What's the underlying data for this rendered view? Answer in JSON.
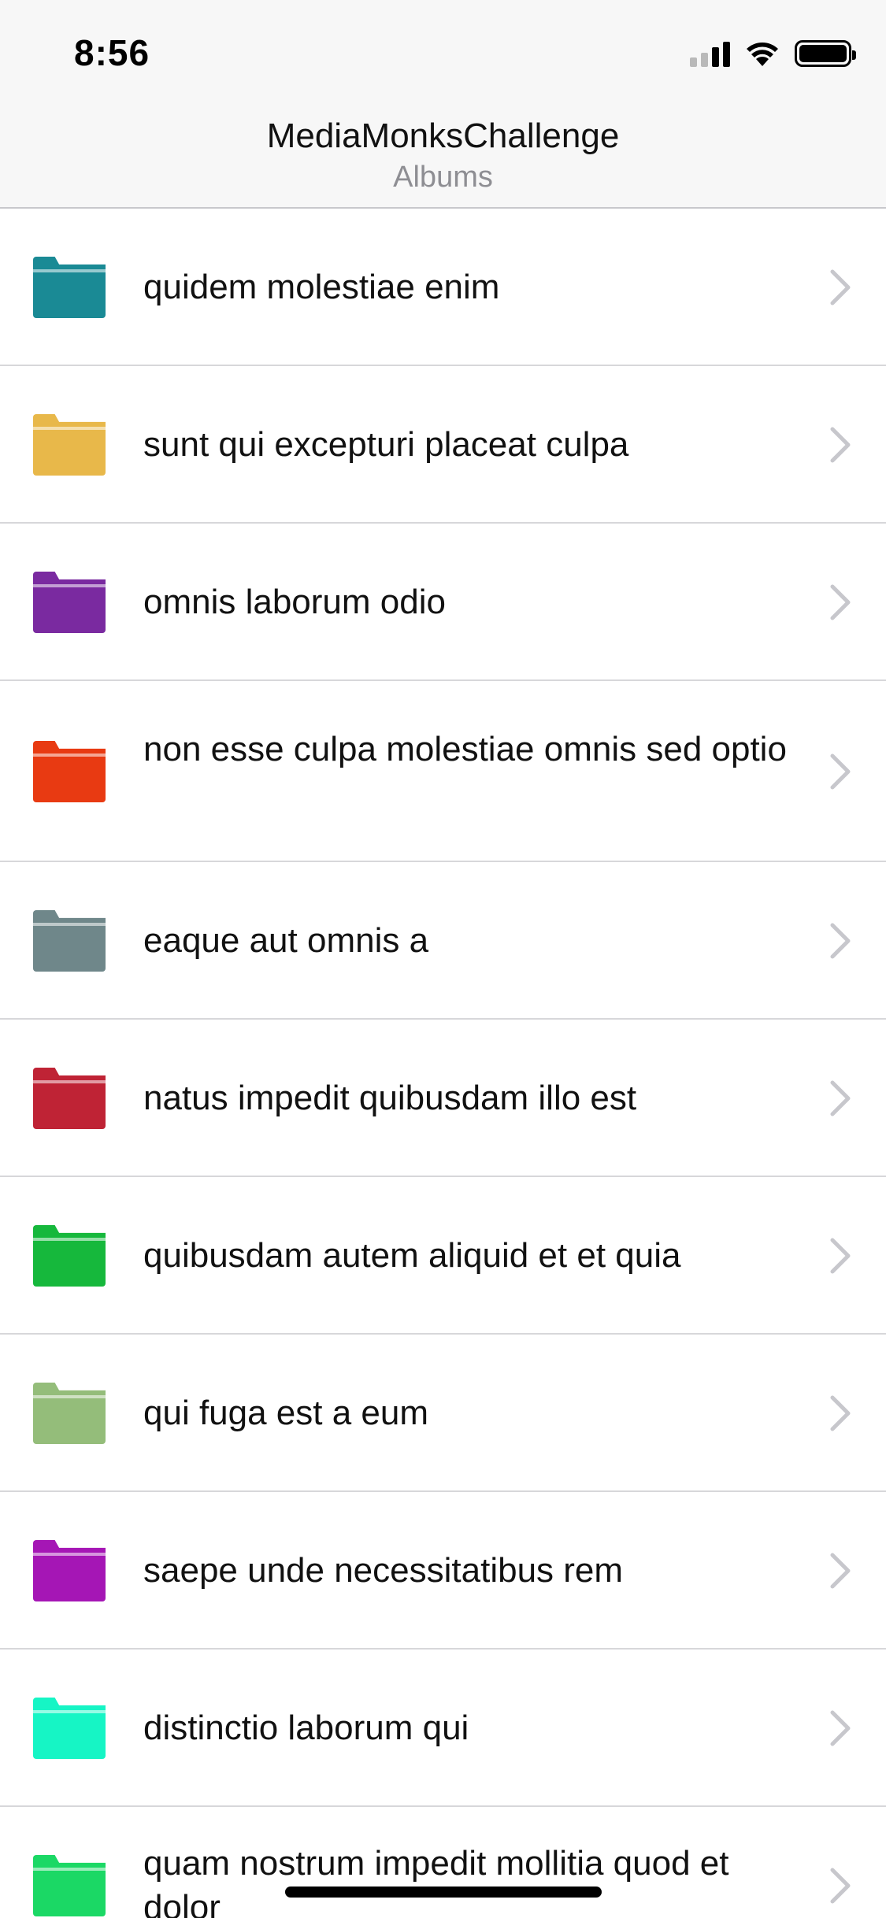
{
  "status_bar": {
    "time": "8:56"
  },
  "nav": {
    "title": "MediaMonksChallenge",
    "subtitle": "Albums"
  },
  "albums": [
    {
      "title": "quidem molestiae enim",
      "color": "#1a8a95"
    },
    {
      "title": "sunt qui excepturi placeat culpa",
      "color": "#e8b84a"
    },
    {
      "title": "omnis laborum odio",
      "color": "#7a2aa0"
    },
    {
      "title": "non esse culpa molestiae omnis sed optio",
      "color": "#e83a12"
    },
    {
      "title": "eaque aut omnis a",
      "color": "#6f878a"
    },
    {
      "title": "natus impedit quibusdam illo est",
      "color": "#bf2335"
    },
    {
      "title": "quibusdam autem aliquid et et quia",
      "color": "#16b83c"
    },
    {
      "title": "qui fuga est a eum",
      "color": "#94bd7a"
    },
    {
      "title": "saepe unde necessitatibus rem",
      "color": "#a516b5"
    },
    {
      "title": "distinctio laborum qui",
      "color": "#16f5c5"
    },
    {
      "title": "quam nostrum impedit mollitia quod et dolor",
      "color": "#1bd865"
    }
  ]
}
